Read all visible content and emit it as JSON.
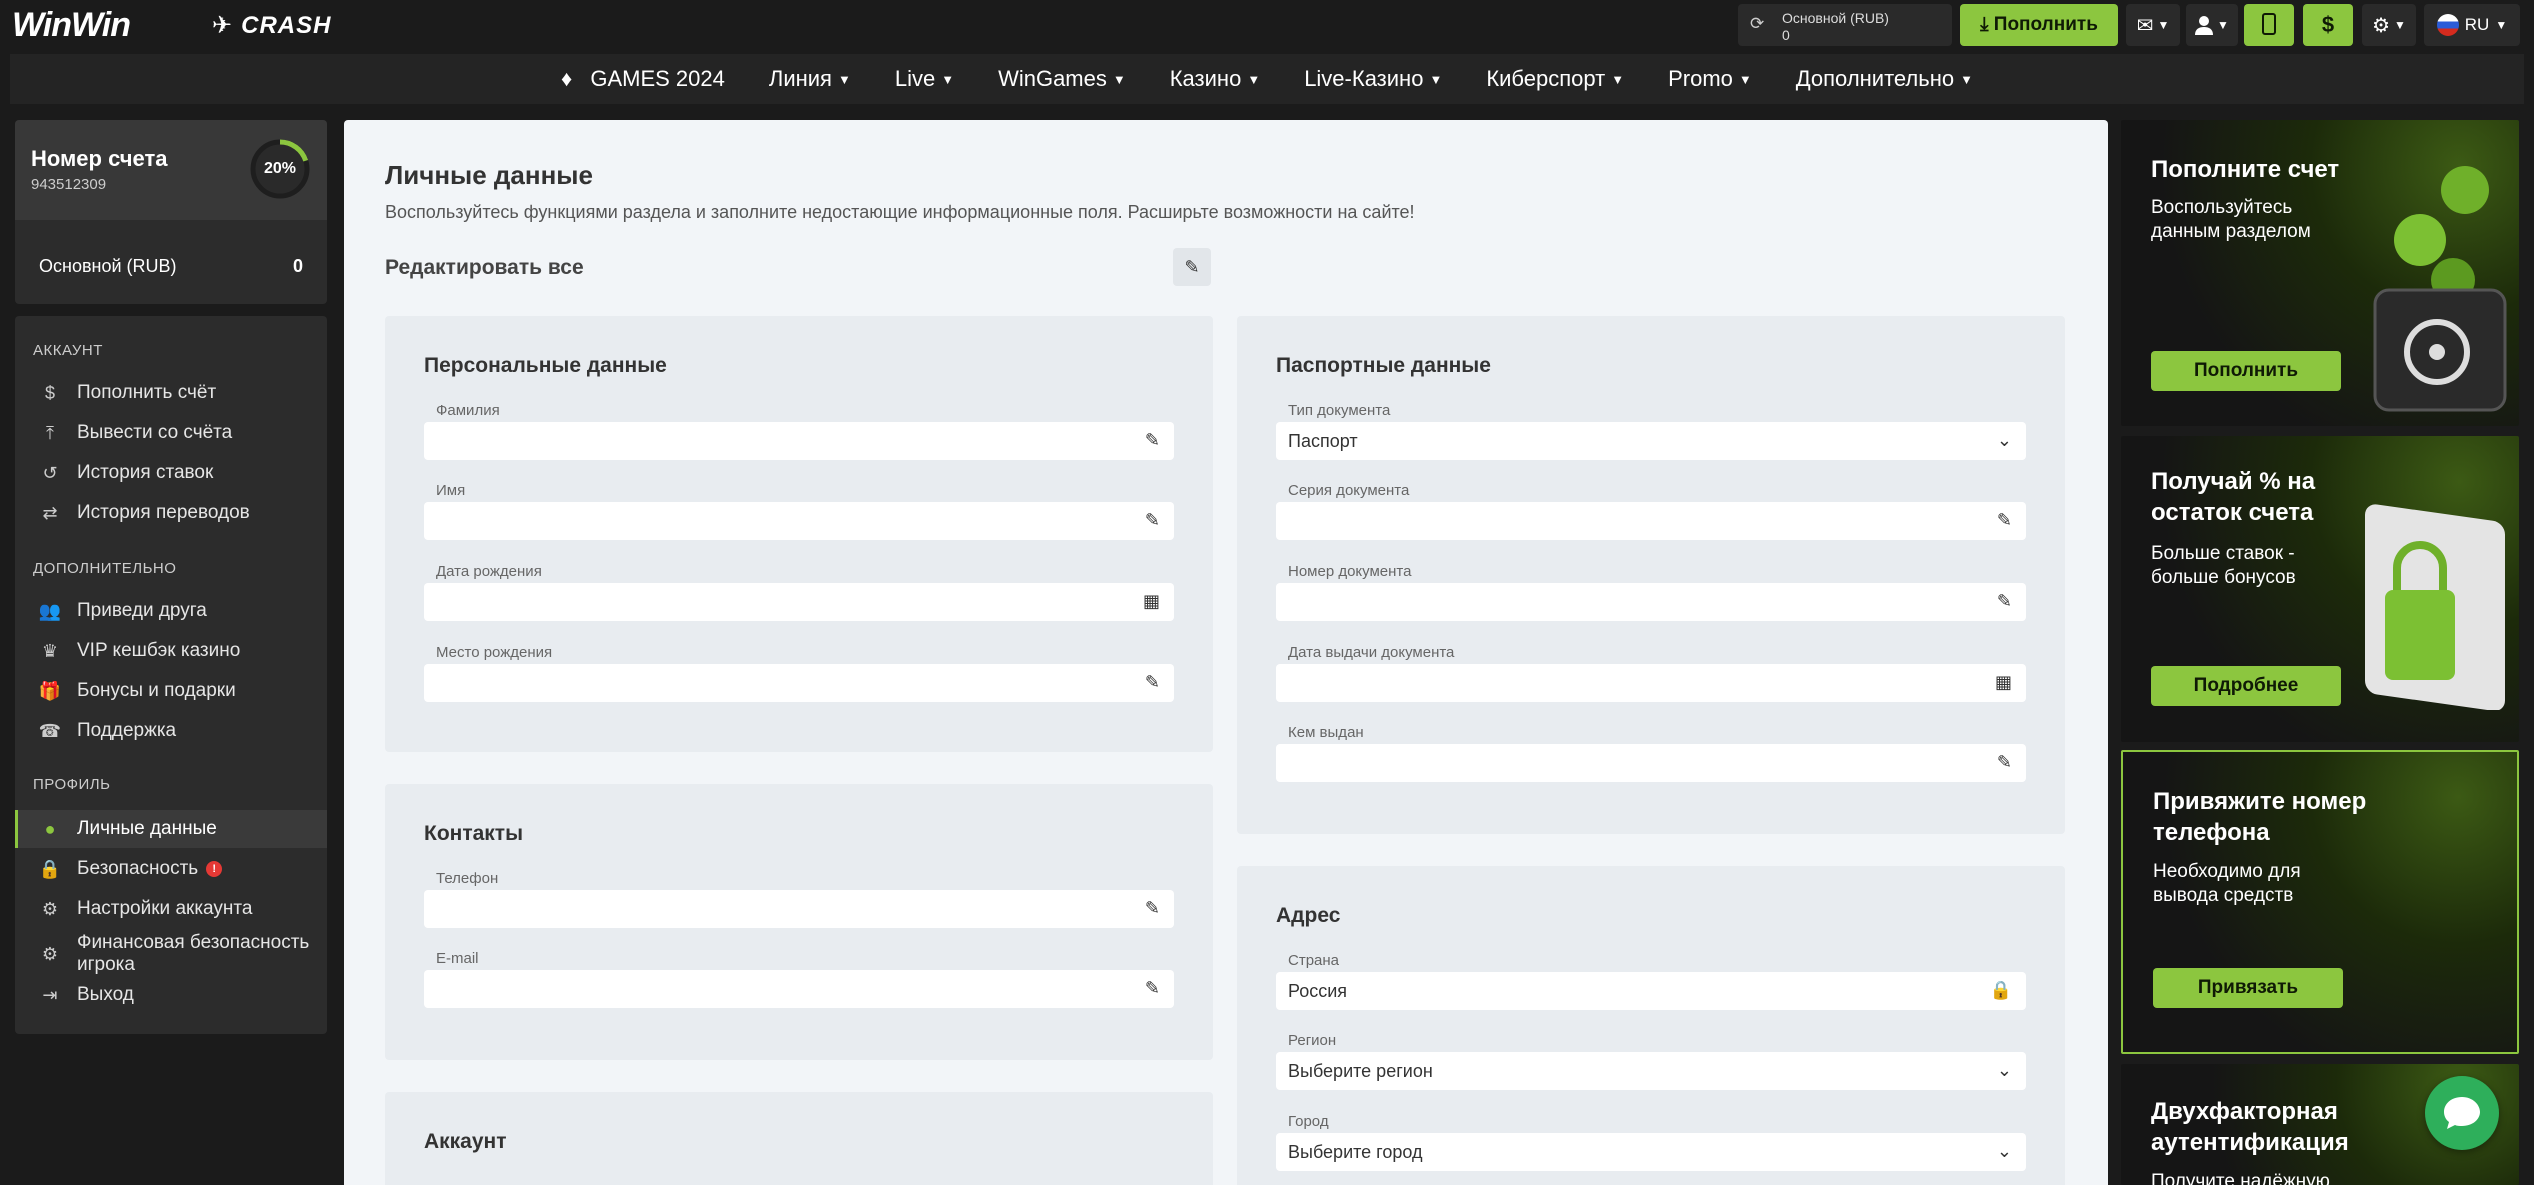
{
  "header": {
    "logo": "WinWin",
    "crash": "CRASH",
    "balance_label": "Основной (RUB)",
    "balance_value": "0",
    "topup": "Пополнить",
    "lang": "RU"
  },
  "nav": {
    "games": "GAMES 2024",
    "items": [
      "Линия",
      "Live",
      "WinGames",
      "Казино",
      "Live-Казино",
      "Киберспорт",
      "Promo",
      "Дополнительно"
    ]
  },
  "account": {
    "title": "Номер счета",
    "number": "943512309",
    "progress": "20%",
    "progress_fraction": 0.2,
    "balance_label": "Основной (RUB)",
    "balance_value": "0"
  },
  "sidebar": {
    "section_account": "АККАУНТ",
    "topup": "Пополнить счёт",
    "withdraw": "Вывести со счёта",
    "bet_history": "История ставок",
    "transfer_history": "История переводов",
    "section_extra": "ДОПОЛНИТЕЛЬНО",
    "invite": "Приведи друга",
    "vip": "VIP кешбэк казино",
    "bonuses": "Бонусы и подарки",
    "support": "Поддержка",
    "section_profile": "ПРОФИЛЬ",
    "personal": "Личные данные",
    "security": "Безопасность",
    "settings": "Настройки аккаунта",
    "financial": "Финансовая безопасность игрока",
    "logout": "Выход"
  },
  "main": {
    "title": "Личные данные",
    "subtitle": "Воспользуйтесь функциями раздела и заполните недостающие информационные поля. Расширьте возможности на сайте!",
    "edit_all": "Редактировать все",
    "personal": {
      "title": "Персональные данные",
      "surname": "Фамилия",
      "name": "Имя",
      "birthdate": "Дата рождения",
      "birthplace": "Место рождения"
    },
    "passport": {
      "title": "Паспортные данные",
      "doc_type_label": "Тип документа",
      "doc_type_value": "Паспорт",
      "series": "Серия документа",
      "number": "Номер документа",
      "issue_date": "Дата выдачи документа",
      "issued_by": "Кем выдан"
    },
    "contacts": {
      "title": "Контакты",
      "phone": "Телефон",
      "email": "E-mail"
    },
    "address": {
      "title": "Адрес",
      "country_label": "Страна",
      "country_value": "Россия",
      "region_label": "Регион",
      "region_value": "Выберите регион",
      "city_label": "Город",
      "city_value": "Выберите город"
    },
    "account_section": {
      "title": "Аккаунт"
    }
  },
  "promos": [
    {
      "title": "Пополните счет",
      "text": "Воспользуйтесь данным разделом",
      "button": "Пополнить"
    },
    {
      "title": "Получай % на остаток счета",
      "text": "Больше ставок - больше бонусов",
      "button": "Подробнее"
    },
    {
      "title": "Привяжите номер телефона",
      "text": "Необходимо для вывода средств",
      "button": "Привязать"
    },
    {
      "title": "Двухфакторная аутентификация",
      "text": "Получите надёжную"
    }
  ],
  "colors": {
    "accent": "#8cc63f",
    "background": "#1b1b1b",
    "content_bg": "#f2f5f8",
    "chat": "#2eaf5b",
    "alert": "#e53935"
  }
}
